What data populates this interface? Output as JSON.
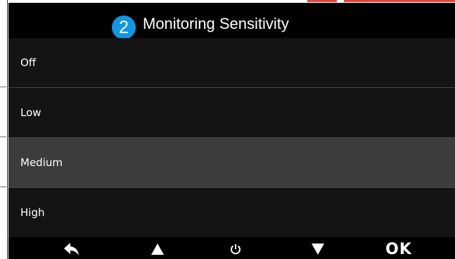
{
  "header": {
    "step_badge": "2",
    "title": "Monitoring Sensitivity"
  },
  "options": [
    {
      "label": "Off",
      "selected": false
    },
    {
      "label": "Low",
      "selected": false
    },
    {
      "label": "Medium",
      "selected": true
    },
    {
      "label": "High",
      "selected": false
    }
  ],
  "bottom_bar": {
    "back_icon": "back-arrow-icon",
    "up_icon": "up-triangle-icon",
    "power_icon": "power-icon",
    "down_icon": "down-triangle-icon",
    "ok_label": "OK"
  },
  "colors": {
    "accent": "#1296e0",
    "selected_row": "#3c3c3c",
    "row": "#141414",
    "frame_marker": "#d9473f"
  }
}
